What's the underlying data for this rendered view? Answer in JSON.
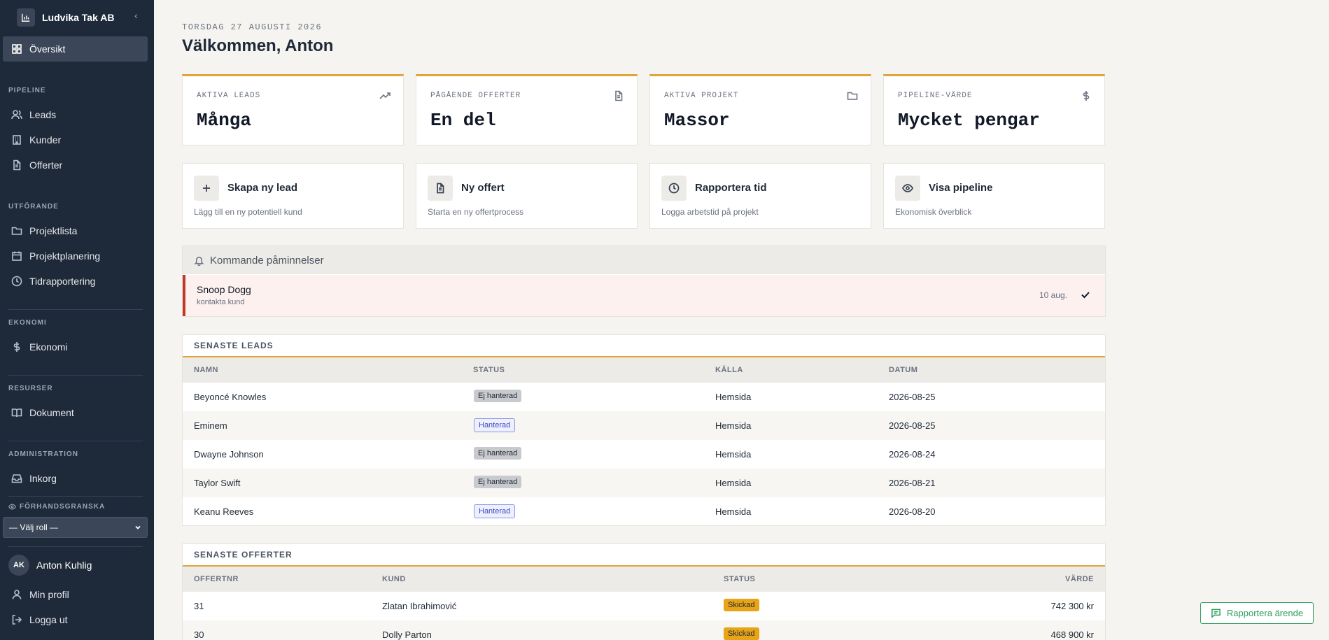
{
  "app": {
    "company": "Ludvika Tak AB",
    "collapse_glyph": "‹",
    "brand_color": "#1e2a3a",
    "accent_color": "#e0a43a"
  },
  "sidebar": {
    "overview": "Översikt",
    "sections": {
      "pipeline": "PIPELINE",
      "execution": "UTFÖRANDE",
      "economy": "EKONOMI",
      "resources": "RESURSER",
      "admin": "ADMINISTRATION"
    },
    "items": {
      "leads": "Leads",
      "customers": "Kunder",
      "offers": "Offerter",
      "project_list": "Projektlista",
      "project_planning": "Projektplanering",
      "time_reporting": "Tidrapportering",
      "economy": "Ekonomi",
      "documents": "Dokument",
      "inbox": "Inkorg"
    },
    "preview_label": "FÖRHANDSGRANSKA",
    "role_select": "— Välj roll —",
    "user_initials": "AK",
    "user_name": "Anton Kuhlig",
    "profile": "Min profil",
    "logout": "Logga ut"
  },
  "header": {
    "date": "TORSDAG 27 AUGUSTI 2026",
    "welcome": "Välkommen, Anton"
  },
  "stats": [
    {
      "label": "AKTIVA LEADS",
      "value": "Många",
      "icon": "trending-up-icon"
    },
    {
      "label": "PÅGÅENDE OFFERTER",
      "value": "En del",
      "icon": "document-icon"
    },
    {
      "label": "AKTIVA PROJEKT",
      "value": "Massor",
      "icon": "folder-icon"
    },
    {
      "label": "PIPELINE-VÄRDE",
      "value": "Mycket pengar",
      "icon": "dollar-icon"
    }
  ],
  "actions": [
    {
      "title": "Skapa ny lead",
      "sub": "Lägg till en ny potentiell kund",
      "icon": "plus-icon"
    },
    {
      "title": "Ny offert",
      "sub": "Starta en ny offertprocess",
      "icon": "document-icon"
    },
    {
      "title": "Rapportera tid",
      "sub": "Logga arbetstid på projekt",
      "icon": "clock-icon"
    },
    {
      "title": "Visa pipeline",
      "sub": "Ekonomisk överblick",
      "icon": "eye-icon"
    }
  ],
  "reminders": {
    "title": "Kommande påminnelser",
    "items": [
      {
        "name": "Snoop Dogg",
        "note": "kontakta kund",
        "date": "10 aug."
      }
    ]
  },
  "leads": {
    "title": "SENASTE LEADS",
    "columns": [
      "NAMN",
      "STATUS",
      "KÄLLA",
      "DATUM"
    ],
    "rows": [
      {
        "name": "Beyoncé Knowles",
        "status": "Ej hanterad",
        "source": "Hemsida",
        "date": "2026-08-25"
      },
      {
        "name": "Eminem",
        "status": "Hanterad",
        "source": "Hemsida",
        "date": "2026-08-25"
      },
      {
        "name": "Dwayne Johnson",
        "status": "Ej hanterad",
        "source": "Hemsida",
        "date": "2026-08-24"
      },
      {
        "name": "Taylor Swift",
        "status": "Ej hanterad",
        "source": "Hemsida",
        "date": "2026-08-21"
      },
      {
        "name": "Keanu Reeves",
        "status": "Hanterad",
        "source": "Hemsida",
        "date": "2026-08-20"
      }
    ]
  },
  "offers": {
    "title": "SENASTE OFFERTER",
    "columns": [
      "OFFERTNR",
      "KUND",
      "STATUS",
      "VÄRDE"
    ],
    "rows": [
      {
        "number": "31",
        "customer": "Zlatan Ibrahimović",
        "status": "Skickad",
        "value": "742 300 kr"
      },
      {
        "number": "30",
        "customer": "Dolly Parton",
        "status": "Skickad",
        "value": "468 900 kr"
      }
    ]
  },
  "report_button": "Rapportera ärende"
}
